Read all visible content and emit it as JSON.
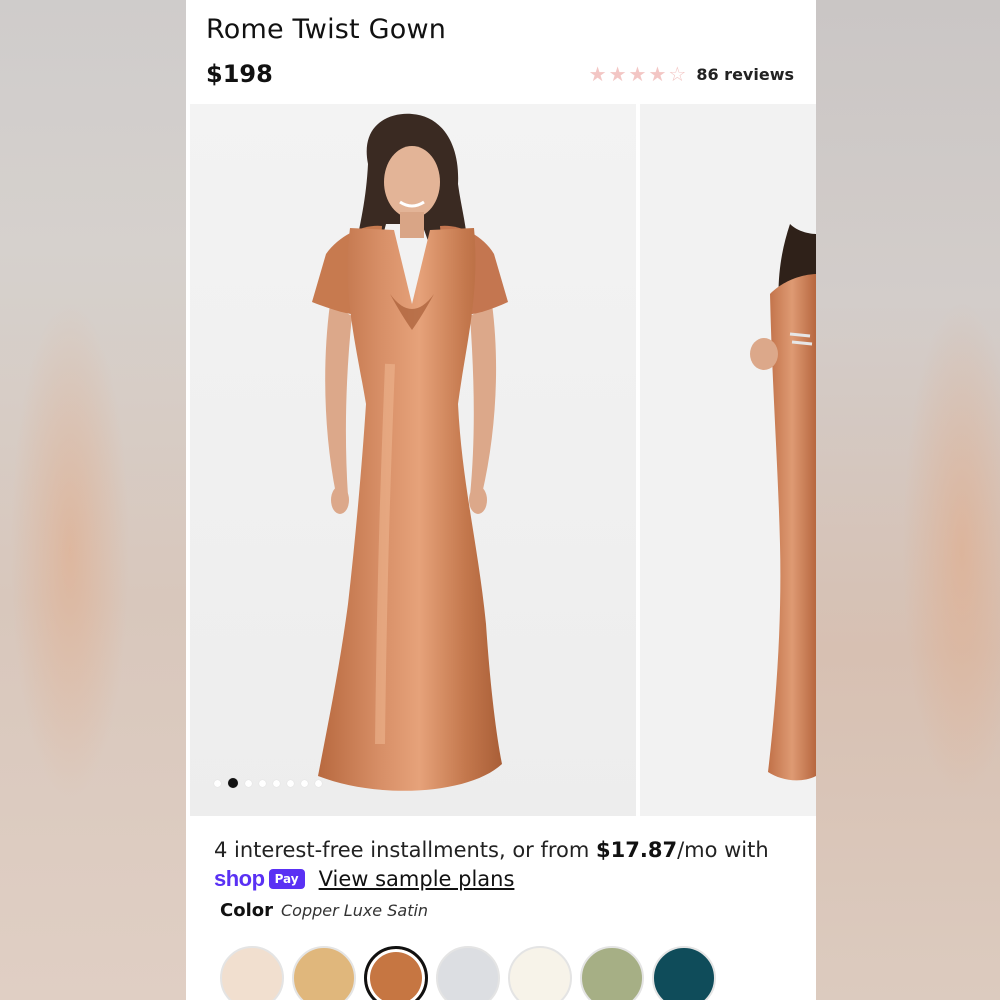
{
  "product": {
    "title": "Rome Twist Gown",
    "price": "$198",
    "rating_value": 4,
    "rating_max": 5,
    "reviews_label": "86 reviews"
  },
  "gallery": {
    "image_count": 8,
    "active_index": 1,
    "main_image_alt": "model wearing copper satin gown",
    "next_image_alt": "side view of gown"
  },
  "installments": {
    "text_before": "4 interest-free installments, or from ",
    "amount": "$17.87",
    "text_after": "/mo with",
    "shop_word": "shop",
    "pay_word": "Pay",
    "link_label": "View sample plans"
  },
  "color": {
    "label": "Color",
    "selected_name": "Copper Luxe Satin",
    "swatches": [
      {
        "name": "cream",
        "hex": "#f1dfcf"
      },
      {
        "name": "gold",
        "hex": "#e0b77c"
      },
      {
        "name": "copper",
        "hex": "#c67642"
      },
      {
        "name": "silver",
        "hex": "#dcdee2"
      },
      {
        "name": "ivory",
        "hex": "#f7f3e9"
      },
      {
        "name": "sage",
        "hex": "#a6af85"
      },
      {
        "name": "teal",
        "hex": "#0f4c5a"
      }
    ],
    "selected_index": 2
  },
  "theme": {
    "star_color": "#f3c6c4",
    "shop_purple": "#5a31f4",
    "dress_color": "#c47a52"
  }
}
